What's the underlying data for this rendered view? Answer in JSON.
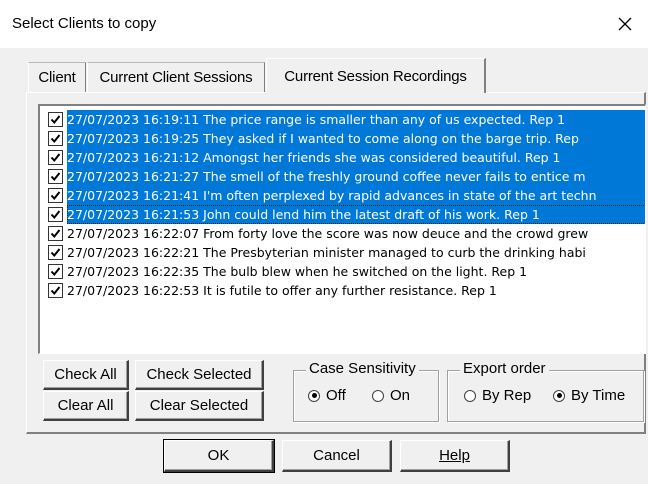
{
  "window": {
    "title": "Select Clients to copy"
  },
  "tabs": [
    {
      "label": "Client"
    },
    {
      "label": "Current Client Sessions"
    },
    {
      "label": "Current Session Recordings"
    }
  ],
  "recordings": [
    {
      "checked": true,
      "selected": true,
      "text": "27/07/2023 16:19:11 The price range is smaller than any of us expected. Rep 1"
    },
    {
      "checked": true,
      "selected": true,
      "text": "27/07/2023 16:19:25 They asked if I wanted to come along on the barge trip. Rep"
    },
    {
      "checked": true,
      "selected": true,
      "text": "27/07/2023 16:21:12 Amongst her friends she was considered beautiful. Rep 1"
    },
    {
      "checked": true,
      "selected": true,
      "text": "27/07/2023 16:21:27 The smell of the freshly ground coffee never fails to entice m"
    },
    {
      "checked": true,
      "selected": true,
      "text": "27/07/2023 16:21:41 I'm often perplexed by rapid advances in state of the art techn"
    },
    {
      "checked": true,
      "selected": true,
      "focused": true,
      "text": "27/07/2023 16:21:53 John could lend him the latest draft of his work. Rep 1"
    },
    {
      "checked": true,
      "selected": false,
      "text": "27/07/2023 16:22:07 From forty love the score was now deuce and the crowd grew"
    },
    {
      "checked": true,
      "selected": false,
      "text": "27/07/2023 16:22:21 The Presbyterian minister managed to curb the drinking habi"
    },
    {
      "checked": true,
      "selected": false,
      "text": "27/07/2023 16:22:35 The bulb blew when he switched on the light. Rep 1"
    },
    {
      "checked": true,
      "selected": false,
      "text": "27/07/2023 16:22:53 It is futile to offer any further resistance. Rep 1"
    }
  ],
  "buttons": {
    "check_all": "Check All",
    "check_selected": "Check Selected",
    "clear_all": "Clear All",
    "clear_selected": "Clear Selected",
    "ok": "OK",
    "cancel": "Cancel",
    "help": "Help"
  },
  "case_sensitivity": {
    "label": "Case Sensitivity",
    "off": "Off",
    "on": "On",
    "selected": "Off"
  },
  "export_order": {
    "label": "Export order",
    "by_rep": "By Rep",
    "by_time": "By Time",
    "selected": "By Time"
  },
  "colors": {
    "selection": "#0078d7",
    "dialog_bg": "#f0f0f0"
  },
  "icons": {
    "close": "close-icon",
    "check": "checkmark-icon"
  }
}
